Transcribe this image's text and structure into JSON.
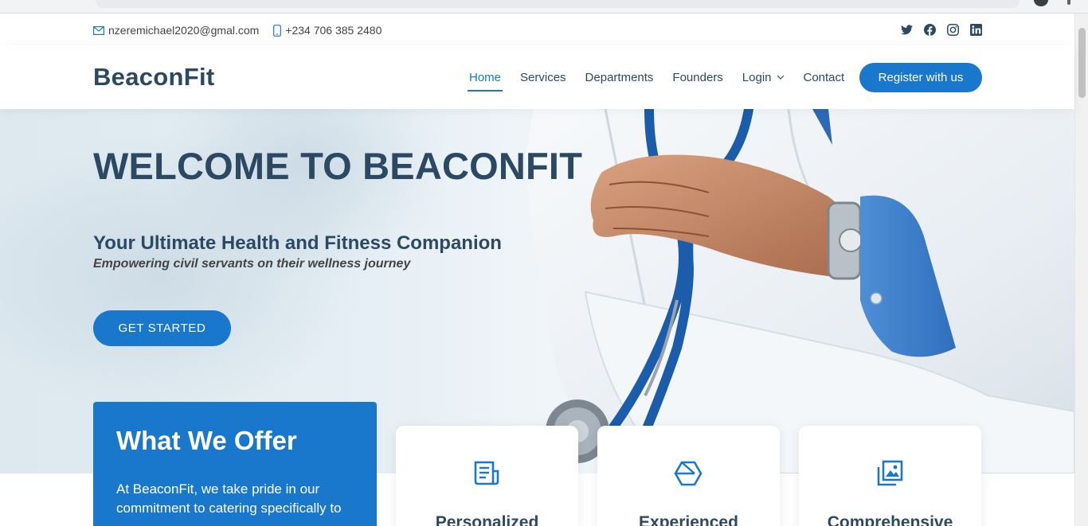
{
  "topbar": {
    "email": "nzeremichael2020@gmal.com",
    "phone": "+234 706 385 2480",
    "socials": [
      "twitter-icon",
      "facebook-icon",
      "instagram-icon",
      "linkedin-icon"
    ]
  },
  "header": {
    "logo": "BeaconFit",
    "nav": {
      "home": "Home",
      "services": "Services",
      "departments": "Departments",
      "founders": "Founders",
      "login": "Login",
      "contact": "Contact"
    },
    "register_label": "Register with us"
  },
  "hero": {
    "title": "WELCOME TO BEACONFIT",
    "subtitle": "Your Ultimate Health and Fitness Companion",
    "tagline": "Empowering civil servants on their wellness journey",
    "cta_label": "GET STARTED"
  },
  "offer": {
    "title": "What We Offer",
    "text": "At BeaconFit, we take pride in our commitment to catering specifically to"
  },
  "cards": [
    {
      "label": "Personalized",
      "icon": "document-icon"
    },
    {
      "label": "Experienced",
      "icon": "cube-icon"
    },
    {
      "label": "Comprehensive",
      "icon": "images-icon"
    }
  ],
  "colors": {
    "accent": "#1977cc",
    "heading": "#2c4964",
    "text": "#444444"
  }
}
